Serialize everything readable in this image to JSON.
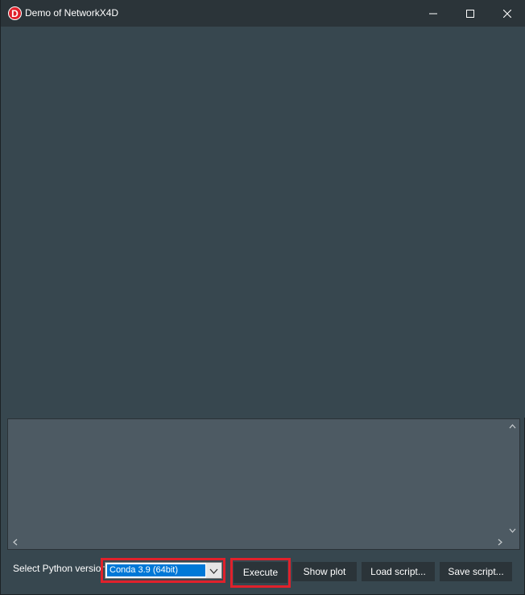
{
  "window": {
    "title": "Demo of NetworkX4D",
    "app_icon_letter": "D",
    "controls": {
      "minimize_icon": "minimize-icon",
      "maximize_icon": "maximize-icon",
      "close_icon": "close-icon"
    }
  },
  "output_panel": {
    "text": ""
  },
  "bottom_bar": {
    "python_label": "Select Python version :",
    "python_version": {
      "selected": "Conda 3.9 (64bit)"
    },
    "buttons": {
      "execute": "Execute",
      "show_plot": "Show plot",
      "load_script": "Load script...",
      "save_script": "Save script..."
    }
  },
  "colors": {
    "background": "#37474f",
    "titlebar": "#2b3439",
    "panel": "#4d5a63",
    "button": "#2b3439",
    "highlight": "#e0212b",
    "selection": "#0078d7"
  }
}
